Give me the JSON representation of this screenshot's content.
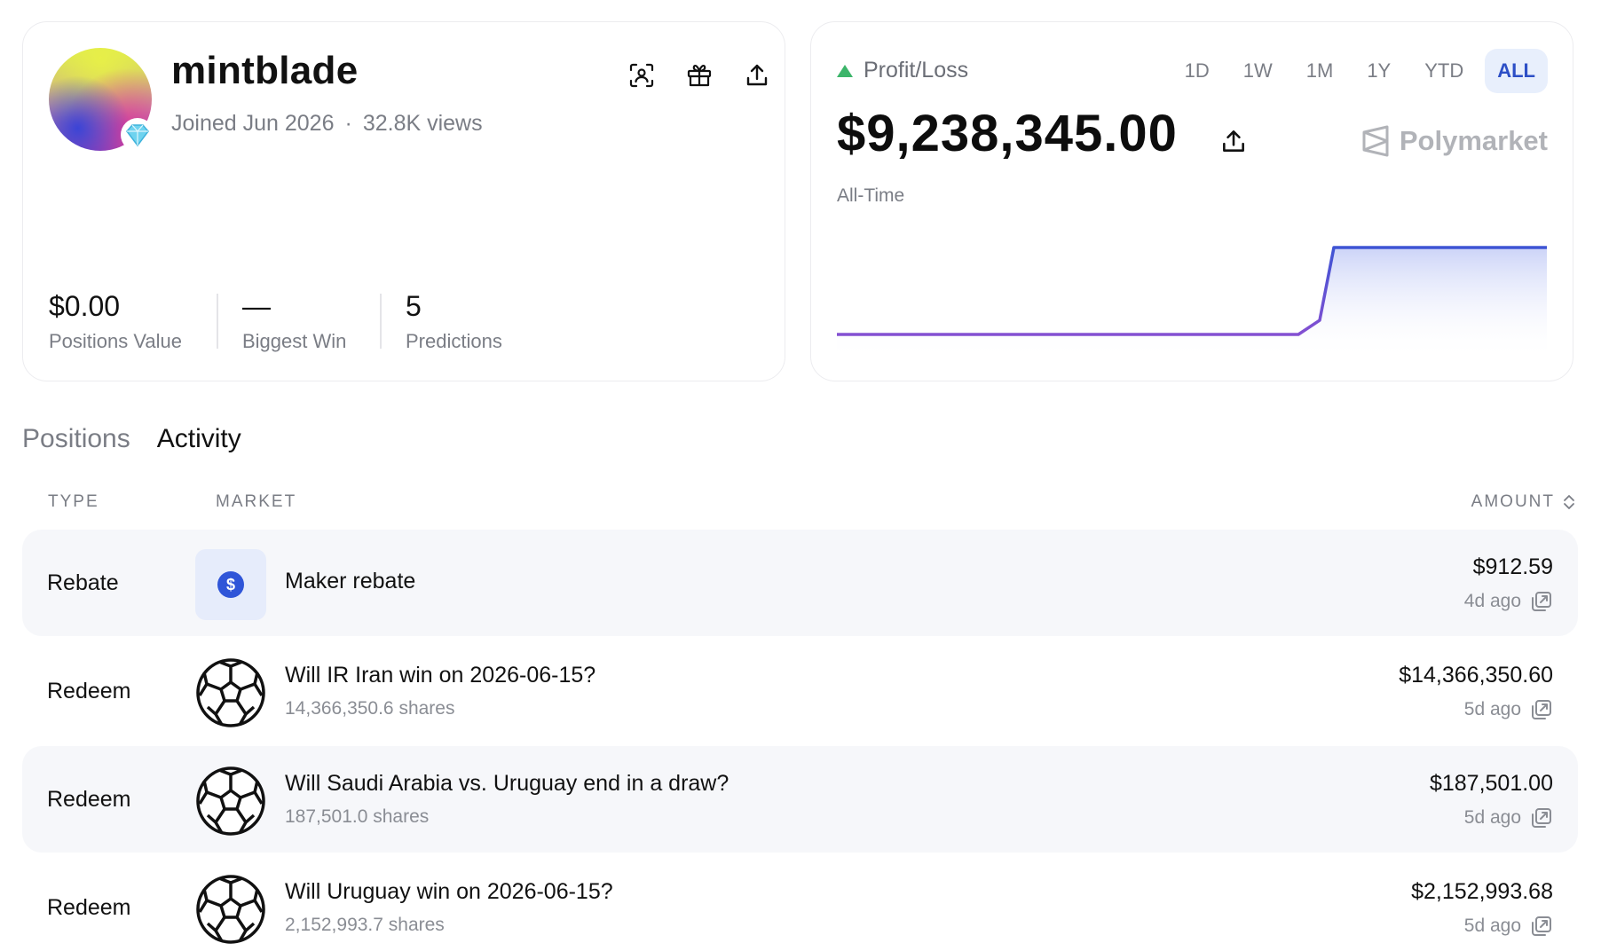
{
  "profile": {
    "username": "mintblade",
    "joined": "Joined Jun 2026",
    "separator": "·",
    "views": "32.8K views",
    "actions": [
      "scan-profile-icon",
      "gift-icon",
      "share-icon"
    ],
    "stats": [
      {
        "value": "$0.00",
        "label": "Positions Value"
      },
      {
        "value": "—",
        "label": "Biggest Win"
      },
      {
        "value": "5",
        "label": "Predictions"
      }
    ]
  },
  "pnl": {
    "label": "Profit/Loss",
    "trend": "up",
    "ranges": [
      "1D",
      "1W",
      "1M",
      "1Y",
      "YTD",
      "ALL"
    ],
    "active_range": "ALL",
    "value": "$9,238,345.00",
    "period": "All-Time",
    "brand": "Polymarket",
    "colors": {
      "line_start": "#7b4fd0",
      "line_end": "#3f55d4",
      "fill": "#dfe4fb",
      "up": "#3cb56a"
    }
  },
  "chart_data": {
    "type": "area",
    "x": [
      0,
      10,
      20,
      30,
      40,
      50,
      60,
      65,
      68,
      70,
      75,
      80,
      90,
      100
    ],
    "y": [
      0,
      0,
      0,
      0,
      0,
      0,
      0,
      0,
      1.5,
      9.24,
      9.24,
      9.24,
      9.24,
      9.24
    ],
    "ylabel": "",
    "xlabel": "",
    "grid": false
  },
  "tabs": [
    {
      "label": "Positions",
      "active": false
    },
    {
      "label": "Activity",
      "active": true
    }
  ],
  "table": {
    "headers": {
      "type": "TYPE",
      "market": "MARKET",
      "amount": "AMOUNT"
    },
    "rows": [
      {
        "type": "Rebate",
        "icon": "dollar-icon",
        "title": "Maker rebate",
        "sub": "",
        "amount": "$912.59",
        "time": "4d ago"
      },
      {
        "type": "Redeem",
        "icon": "soccer-ball-icon",
        "title": "Will IR Iran win on 2026-06-15?",
        "sub": "14,366,350.6 shares",
        "amount": "$14,366,350.60",
        "time": "5d ago"
      },
      {
        "type": "Redeem",
        "icon": "soccer-ball-icon",
        "title": "Will Saudi Arabia vs. Uruguay end in a draw?",
        "sub": "187,501.0 shares",
        "amount": "$187,501.00",
        "time": "5d ago"
      },
      {
        "type": "Redeem",
        "icon": "soccer-ball-icon",
        "title": "Will Uruguay win on 2026-06-15?",
        "sub": "2,152,993.7 shares",
        "amount": "$2,152,993.68",
        "time": "5d ago"
      }
    ]
  }
}
